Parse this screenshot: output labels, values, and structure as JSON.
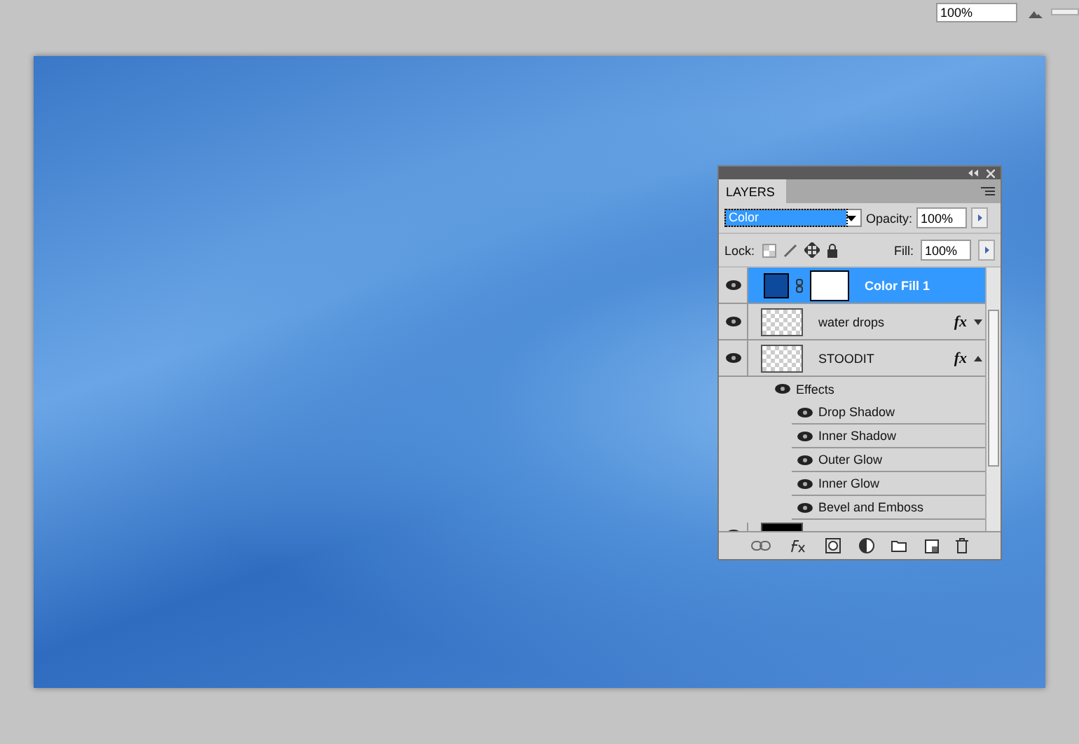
{
  "zoom_field": {
    "value": "100%"
  },
  "layers_panel": {
    "tab": "LAYERS",
    "blend_mode": "Color",
    "opacity_label": "Opacity:",
    "opacity": "100%",
    "lock_label": "Lock:",
    "fill_label": "Fill:",
    "fill": "100%",
    "layers": [
      {
        "name": "Color Fill 1",
        "kind": "fill",
        "selected": true,
        "visible": true
      },
      {
        "name": "water drops",
        "kind": "pixel",
        "selected": false,
        "visible": true,
        "fx": "fx",
        "expanded": false
      },
      {
        "name": "STOODIT",
        "kind": "text",
        "selected": false,
        "visible": true,
        "fx": "fx",
        "expanded": true,
        "effects_label": "Effects",
        "effects": [
          {
            "name": "Drop Shadow",
            "visible": true
          },
          {
            "name": "Inner Shadow",
            "visible": true
          },
          {
            "name": "Outer Glow",
            "visible": true
          },
          {
            "name": "Inner Glow",
            "visible": true
          },
          {
            "name": "Bevel and Emboss",
            "visible": true
          }
        ]
      },
      {
        "kind": "dark",
        "selected": false,
        "visible": true
      }
    ]
  }
}
